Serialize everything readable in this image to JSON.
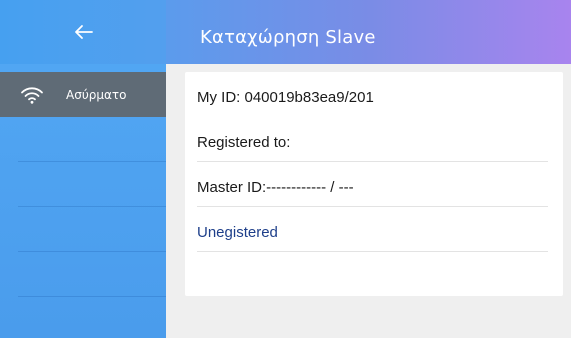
{
  "header": {
    "title": "Καταχώρηση Slave",
    "back_icon": "arrow-left-icon"
  },
  "sidebar": {
    "items": [
      {
        "label": "Ασύρματο",
        "icon": "wifi-icon",
        "active": true
      }
    ]
  },
  "info": {
    "my_id": "My ID: 040019b83ea9/201",
    "registered_to": "Registered to:",
    "master_id": "Master ID:------------ / ---",
    "status": "Unegistered"
  },
  "colors": {
    "header_start": "#4aa2f0",
    "header_end": "#a884ee",
    "sidebar": "#4fa3f1",
    "sidebar_active": "#5f6b76",
    "status_text": "#1e3f8a"
  }
}
